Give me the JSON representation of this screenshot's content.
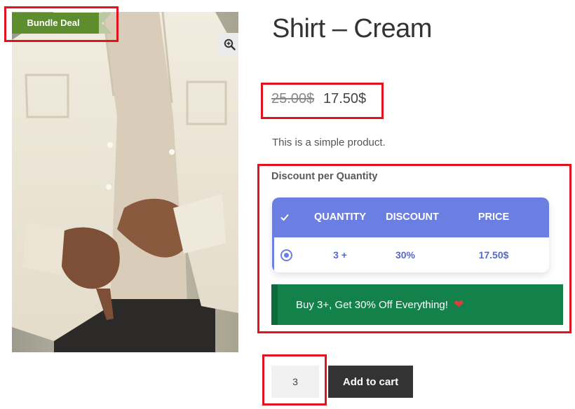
{
  "product": {
    "title": "Shirt – Cream",
    "badge": "Bundle Deal",
    "old_price": "25.00$",
    "new_price": "17.50$",
    "description": "This is a simple product."
  },
  "discount": {
    "heading": "Discount per Quantity",
    "columns": [
      "QUANTITY",
      "DISCOUNT",
      "PRICE"
    ],
    "rows": [
      {
        "quantity": "3 +",
        "discount": "30%",
        "price": "17.50$",
        "selected": true
      }
    ]
  },
  "promo": {
    "text": "Buy 3+, Get 30% Off Everything!",
    "emoji": "❤"
  },
  "cart": {
    "quantity": "3",
    "button_label": "Add to cart"
  },
  "colors": {
    "badge": "#5d8d2c",
    "table_header": "#6b7ee1",
    "table_text": "#5668c9",
    "promo_bg": "#12814a",
    "highlight": "#e0141e",
    "button": "#333333"
  },
  "icons": [
    "zoom-icon",
    "check-icon",
    "radio-selected-icon",
    "heart-icon"
  ]
}
